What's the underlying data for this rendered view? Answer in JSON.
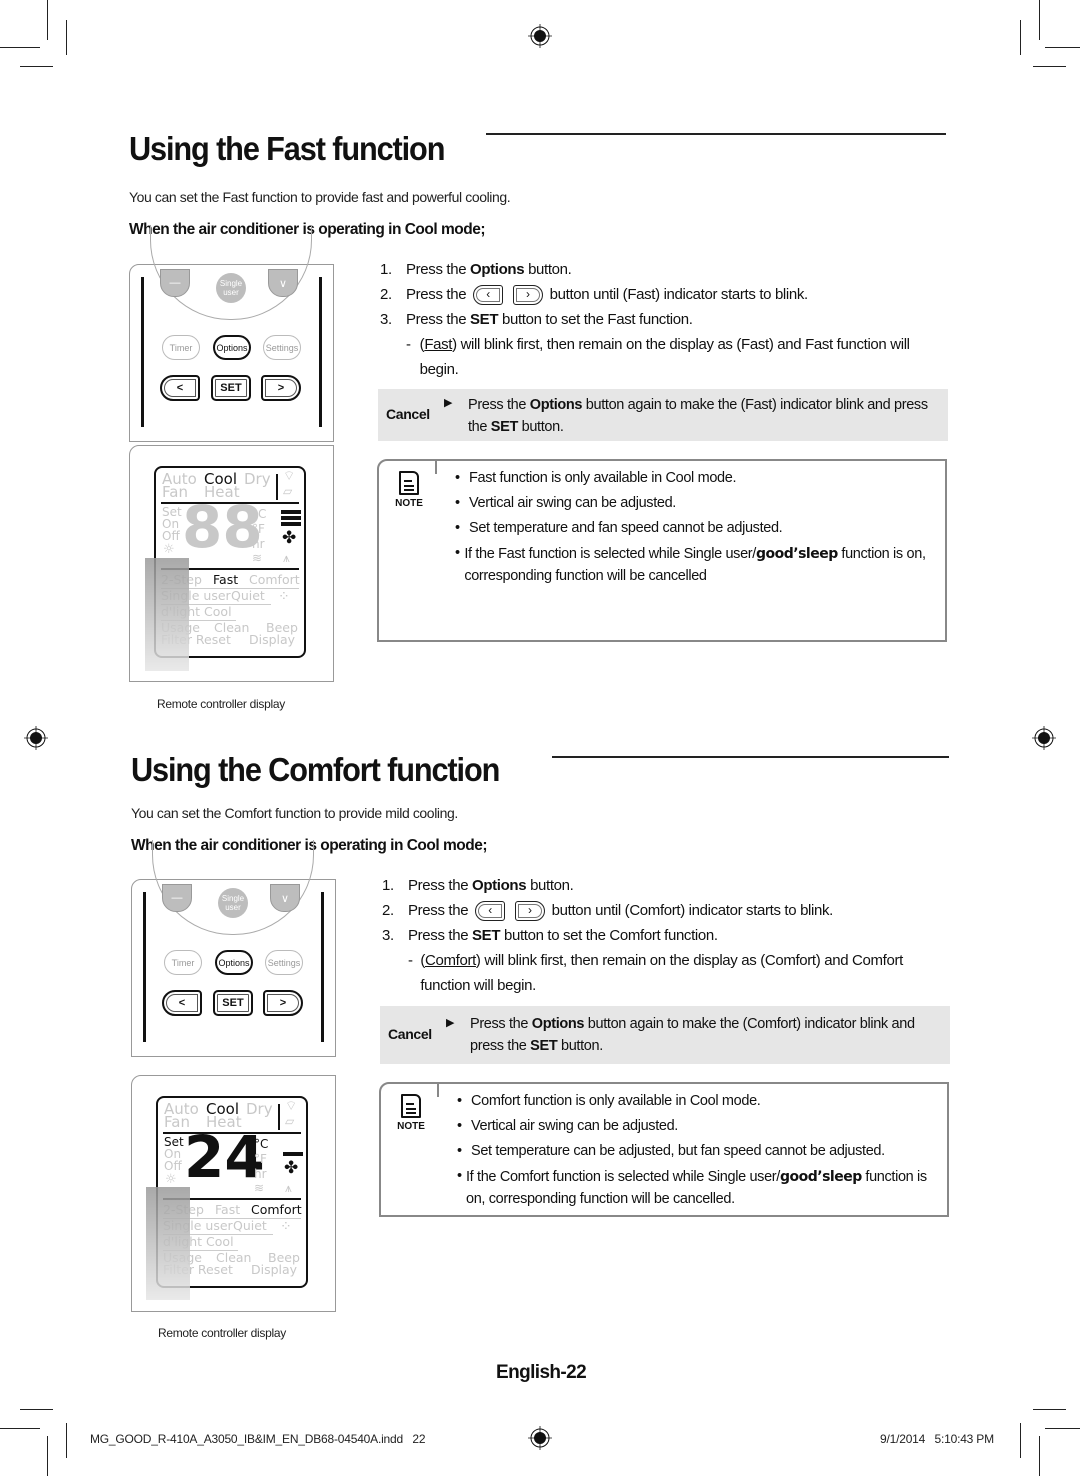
{
  "sections": [
    {
      "title": "Using the Fast function",
      "intro": "You can set the Fast function to provide fast and powerful cooling.",
      "condition": "When the air conditioner is operating in Cool mode;",
      "steps": [
        {
          "num": "1.",
          "pre": "Press the ",
          "bold": "Options",
          "post": " button."
        },
        {
          "num": "2.",
          "pre": "Press the ",
          "post": " button until (Fast) indicator starts to blink."
        },
        {
          "num": "3.",
          "pre": "Press the ",
          "bold": "SET",
          "post": " button to set the Fast function."
        }
      ],
      "substep": {
        "dash": "-",
        "underlined": "Fast",
        "text": ") will blink first, then remain on the display as (Fast) and Fast function will begin."
      },
      "cancel": {
        "label": "Cancel",
        "pre": "Press the ",
        "bold1": "Options",
        "mid": " button again to make the (Fast) indicator blink and press the ",
        "bold2": "SET",
        "post": " button."
      },
      "note": {
        "label": "NOTE",
        "items": [
          "Fast function is only available in Cool mode.",
          "Vertical air swing can be adjusted.",
          "Set temperature and fan speed cannot be adjusted."
        ],
        "last": {
          "pre": "If the Fast function is selected while Single user/",
          "brand": "good’sleep",
          "post": " function is on, corresponding function will be cancelled"
        }
      },
      "remote": {
        "buttons_top": [
          "—",
          "Single user",
          "∨"
        ],
        "buttons_mid": [
          "Timer",
          "Options",
          "Settings"
        ],
        "buttons_nav": [
          "<",
          "SET",
          ">"
        ],
        "active_button": "Options"
      },
      "display": {
        "modes_row1": [
          "Auto",
          "Cool",
          "Dry"
        ],
        "modes_row2": [
          "Fan",
          "Heat"
        ],
        "active_mode": "Cool",
        "left_labels": [
          "Set",
          "On",
          "Off"
        ],
        "set_active": false,
        "temperature": "88",
        "temp_active": false,
        "units": [
          "°C",
          "°F",
          "hr"
        ],
        "functions_row1": [
          "2-Step",
          "Fast",
          "Comfort"
        ],
        "active_function": "Fast",
        "functions_row2": [
          "Single user",
          "Quiet"
        ],
        "functions_row3": "d'light Cool",
        "functions_row4": [
          "Usage",
          "Clean",
          "Beep"
        ],
        "functions_row5": [
          "Filter Reset",
          "Display"
        ],
        "fan_level": "high"
      },
      "caption": "Remote controller display"
    },
    {
      "title": "Using the Comfort function",
      "intro": "You can set the Comfort function to provide mild cooling.",
      "condition": "When the air conditioner is operating in Cool mode;",
      "steps": [
        {
          "num": "1.",
          "pre": "Press the ",
          "bold": "Options",
          "post": " button."
        },
        {
          "num": "2.",
          "pre": "Press the ",
          "post": " button until (Comfort) indicator starts to blink."
        },
        {
          "num": "3.",
          "pre": "Press the ",
          "bold": "SET",
          "post": " button to set the Comfort function."
        }
      ],
      "substep": {
        "dash": "-",
        "underlined": "Comfort",
        "text": ") will blink first, then remain on the display as (Comfort) and Comfort function will begin."
      },
      "cancel": {
        "label": "Cancel",
        "pre": "Press the ",
        "bold1": "Options",
        "mid": " button again to make the (Comfort) indicator blink and press the ",
        "bold2": "SET",
        "post": " button."
      },
      "note": {
        "label": "NOTE",
        "items": [
          "Comfort function is only available in Cool mode.",
          "Vertical air swing can be adjusted.",
          "Set temperature can be adjusted, but fan speed cannot be adjusted."
        ],
        "last": {
          "pre": "If the Comfort function is selected while Single user/",
          "brand": "good’sleep",
          "post": " function is on, corresponding function will be cancelled."
        }
      },
      "remote": {
        "buttons_top": [
          "—",
          "Single user",
          "∨"
        ],
        "buttons_mid": [
          "Timer",
          "Options",
          "Settings"
        ],
        "buttons_nav": [
          "<",
          "SET",
          ">"
        ],
        "active_button": "Options"
      },
      "display": {
        "modes_row1": [
          "Auto",
          "Cool",
          "Dry"
        ],
        "modes_row2": [
          "Fan",
          "Heat"
        ],
        "active_mode": "Cool",
        "left_labels": [
          "Set",
          "On",
          "Off"
        ],
        "set_active": true,
        "temperature": "24",
        "temp_active": true,
        "units": [
          "°C",
          "°F",
          "hr"
        ],
        "functions_row1": [
          "2-Step",
          "Fast",
          "Comfort"
        ],
        "active_function": "Comfort",
        "functions_row2": [
          "Single user",
          "Quiet"
        ],
        "functions_row3": "d'light Cool",
        "functions_row4": [
          "Usage",
          "Clean",
          "Beep"
        ],
        "functions_row5": [
          "Filter Reset",
          "Display"
        ],
        "fan_level": "low"
      },
      "caption": "Remote controller display"
    }
  ],
  "page_number": "English-22",
  "footer": {
    "file": "MG_GOOD_R-410A_A3050_IB&IM_EN_DB68-04540A.indd   22",
    "datetime": "9/1/2014   5:10:43 PM"
  }
}
